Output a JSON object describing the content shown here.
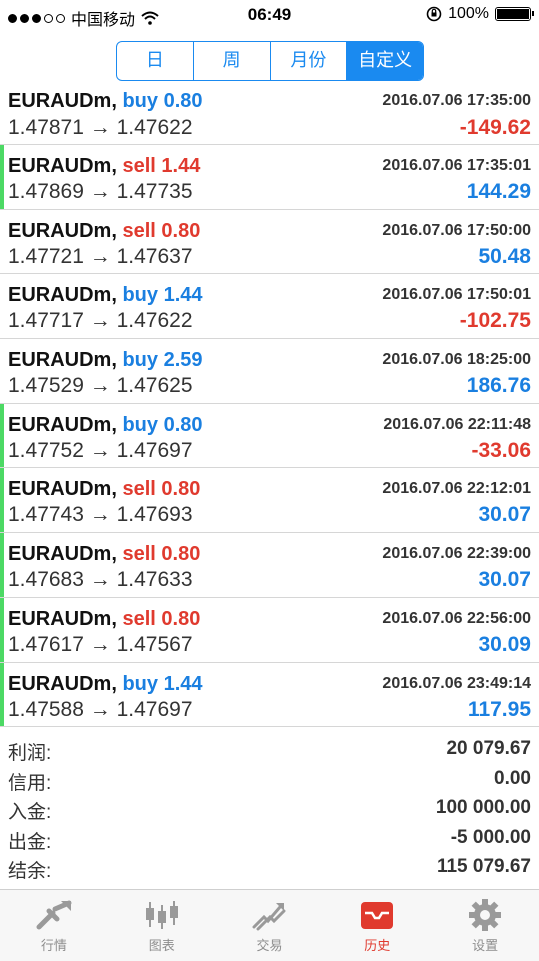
{
  "status_bar": {
    "carrier": "中国移动",
    "time": "06:49",
    "battery": "100%"
  },
  "segmented": {
    "tabs": [
      "日",
      "周",
      "月份",
      "自定义"
    ],
    "active_index": 3
  },
  "trades": [
    {
      "symbol": "EURAUDm,",
      "action": "buy 0.80",
      "side": "buy",
      "time": "2016.07.06 17:35:00",
      "open": "1.47871",
      "arrow": "→",
      "close": "1.47622",
      "profit": "-149.62"
    },
    {
      "symbol": "EURAUDm,",
      "action": "sell 1.44",
      "side": "sell",
      "time": "2016.07.06 17:35:01",
      "open": "1.47869",
      "arrow": "→",
      "close": "1.47735",
      "profit": "144.29"
    },
    {
      "symbol": "EURAUDm,",
      "action": "sell 0.80",
      "side": "sell",
      "time": "2016.07.06 17:50:00",
      "open": "1.47721",
      "arrow": "→",
      "close": "1.47637",
      "profit": "50.48"
    },
    {
      "symbol": "EURAUDm,",
      "action": "buy 1.44",
      "side": "buy",
      "time": "2016.07.06 17:50:01",
      "open": "1.47717",
      "arrow": "→",
      "close": "1.47622",
      "profit": "-102.75"
    },
    {
      "symbol": "EURAUDm,",
      "action": "buy 2.59",
      "side": "buy",
      "time": "2016.07.06 18:25:00",
      "open": "1.47529",
      "arrow": "→",
      "close": "1.47625",
      "profit": "186.76"
    },
    {
      "symbol": "EURAUDm,",
      "action": "buy 0.80",
      "side": "buy",
      "time": "2016.07.06 22:11:48",
      "open": "1.47752",
      "arrow": "→",
      "close": "1.47697",
      "profit": "-33.06"
    },
    {
      "symbol": "EURAUDm,",
      "action": "sell 0.80",
      "side": "sell",
      "time": "2016.07.06 22:12:01",
      "open": "1.47743",
      "arrow": "→",
      "close": "1.47693",
      "profit": "30.07"
    },
    {
      "symbol": "EURAUDm,",
      "action": "sell 0.80",
      "side": "sell",
      "time": "2016.07.06 22:39:00",
      "open": "1.47683",
      "arrow": "→",
      "close": "1.47633",
      "profit": "30.07"
    },
    {
      "symbol": "EURAUDm,",
      "action": "sell 0.80",
      "side": "sell",
      "time": "2016.07.06 22:56:00",
      "open": "1.47617",
      "arrow": "→",
      "close": "1.47567",
      "profit": "30.09"
    },
    {
      "symbol": "EURAUDm,",
      "action": "buy 1.44",
      "side": "buy",
      "time": "2016.07.06 23:49:14",
      "open": "1.47588",
      "arrow": "→",
      "close": "1.47697",
      "profit": "117.95"
    }
  ],
  "summary": [
    {
      "label": "利润:",
      "value": "20 079.67"
    },
    {
      "label": "信用:",
      "value": "0.00"
    },
    {
      "label": "入金:",
      "value": "100 000.00"
    },
    {
      "label": "出金:",
      "value": "-5 000.00"
    },
    {
      "label": "结余:",
      "value": "115 079.67"
    }
  ],
  "tabbar": {
    "tabs": [
      {
        "label": "行情",
        "icon": "quotes-icon"
      },
      {
        "label": "图表",
        "icon": "chart-icon"
      },
      {
        "label": "交易",
        "icon": "trade-icon"
      },
      {
        "label": "历史",
        "icon": "history-icon"
      },
      {
        "label": "设置",
        "icon": "settings-icon"
      }
    ],
    "active_index": 3
  },
  "colors": {
    "accent": "#1a8af0",
    "buy": "#1a7fe0",
    "sell": "#e03a2e",
    "marker": "#4cd964"
  }
}
